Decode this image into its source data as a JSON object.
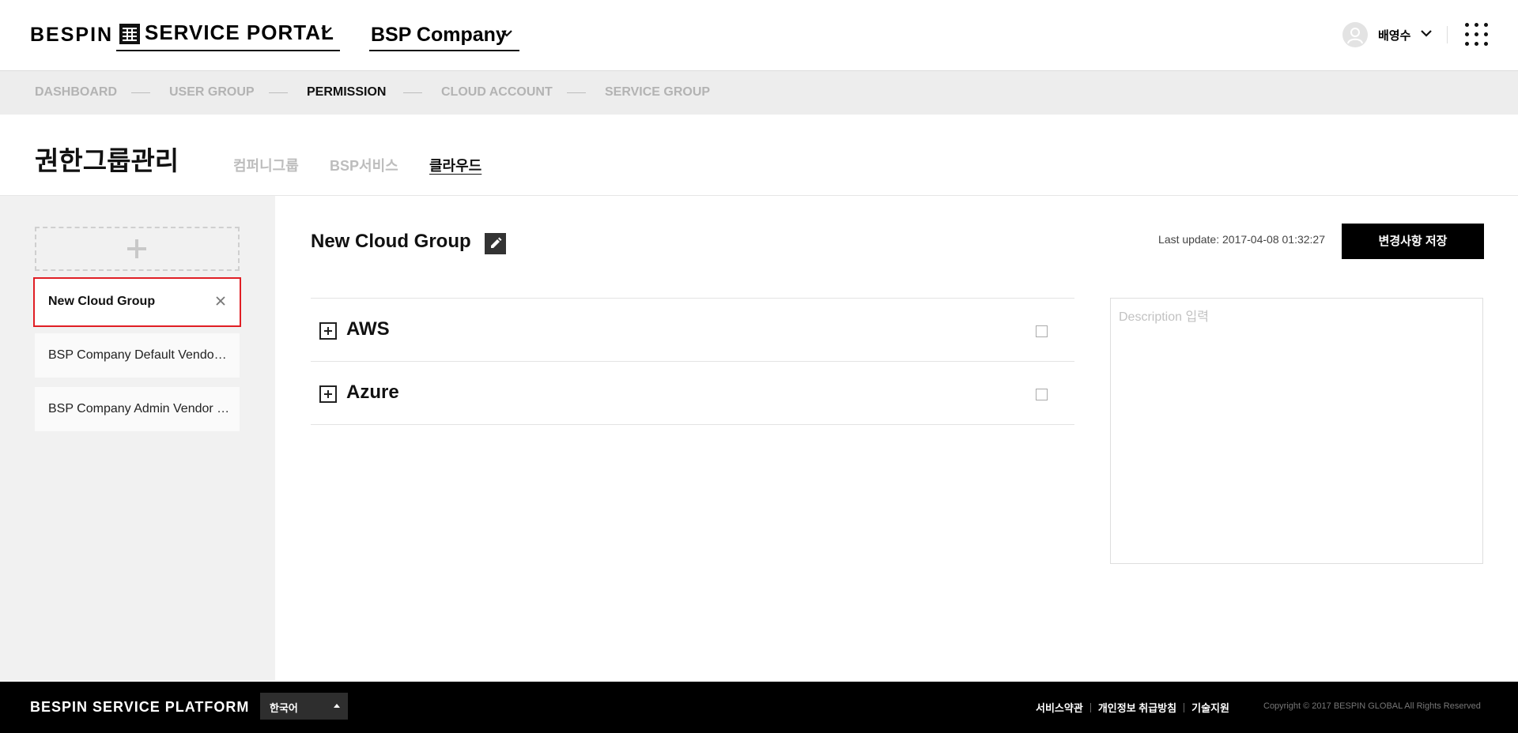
{
  "header": {
    "logo": "BESPIN",
    "portal_label": "SERVICE PORTAL",
    "company_label": "BSP Company",
    "user_name": "배영수"
  },
  "steps": [
    {
      "label": "DASHBOARD",
      "active": false
    },
    {
      "label": "USER GROUP",
      "active": false
    },
    {
      "label": "PERMISSION",
      "active": true
    },
    {
      "label": "CLOUD ACCOUNT",
      "active": false
    },
    {
      "label": "SERVICE GROUP",
      "active": false
    }
  ],
  "page": {
    "title": "권한그룹관리",
    "tabs": [
      {
        "label": "컴퍼니그룹",
        "active": false
      },
      {
        "label": "BSP서비스",
        "active": false
      },
      {
        "label": "클라우드",
        "active": true
      }
    ]
  },
  "sidebar": {
    "groups": [
      {
        "label": "New Cloud Group",
        "selected": true
      },
      {
        "label": "BSP Company Default Vendor Group",
        "selected": false
      },
      {
        "label": "BSP Company Admin Vendor Group",
        "selected": false
      }
    ]
  },
  "main": {
    "group_name": "New Cloud Group",
    "last_update": "Last update: 2017-04-08 01:32:27",
    "save_label": "변경사항 저장",
    "vendors": [
      {
        "label": "AWS",
        "checked": false
      },
      {
        "label": "Azure",
        "checked": false
      }
    ],
    "description_placeholder": "Description 입력",
    "description_value": ""
  },
  "footer": {
    "brand": "BESPIN SERVICE PLATFORM",
    "language": "한국어",
    "links": [
      "서비스약관",
      "개인정보 취급방침",
      "기술지원"
    ],
    "copyright": "Copyright © 2017 BESPIN GLOBAL All Rights Reserved"
  },
  "colors": {
    "accent_selected_border": "#e01e24",
    "primary_button": "#000000",
    "step_bar": "#ededed",
    "sidebar_bg": "#f1f1f1",
    "footer_bg": "#000000"
  },
  "icons": [
    "grid-logo-icon",
    "chevron-down-icon",
    "user-avatar-icon",
    "apps-grid-icon",
    "plus-icon",
    "close-icon",
    "pencil-icon",
    "expand-plus-icon",
    "checkbox",
    "triangle-up-icon"
  ]
}
